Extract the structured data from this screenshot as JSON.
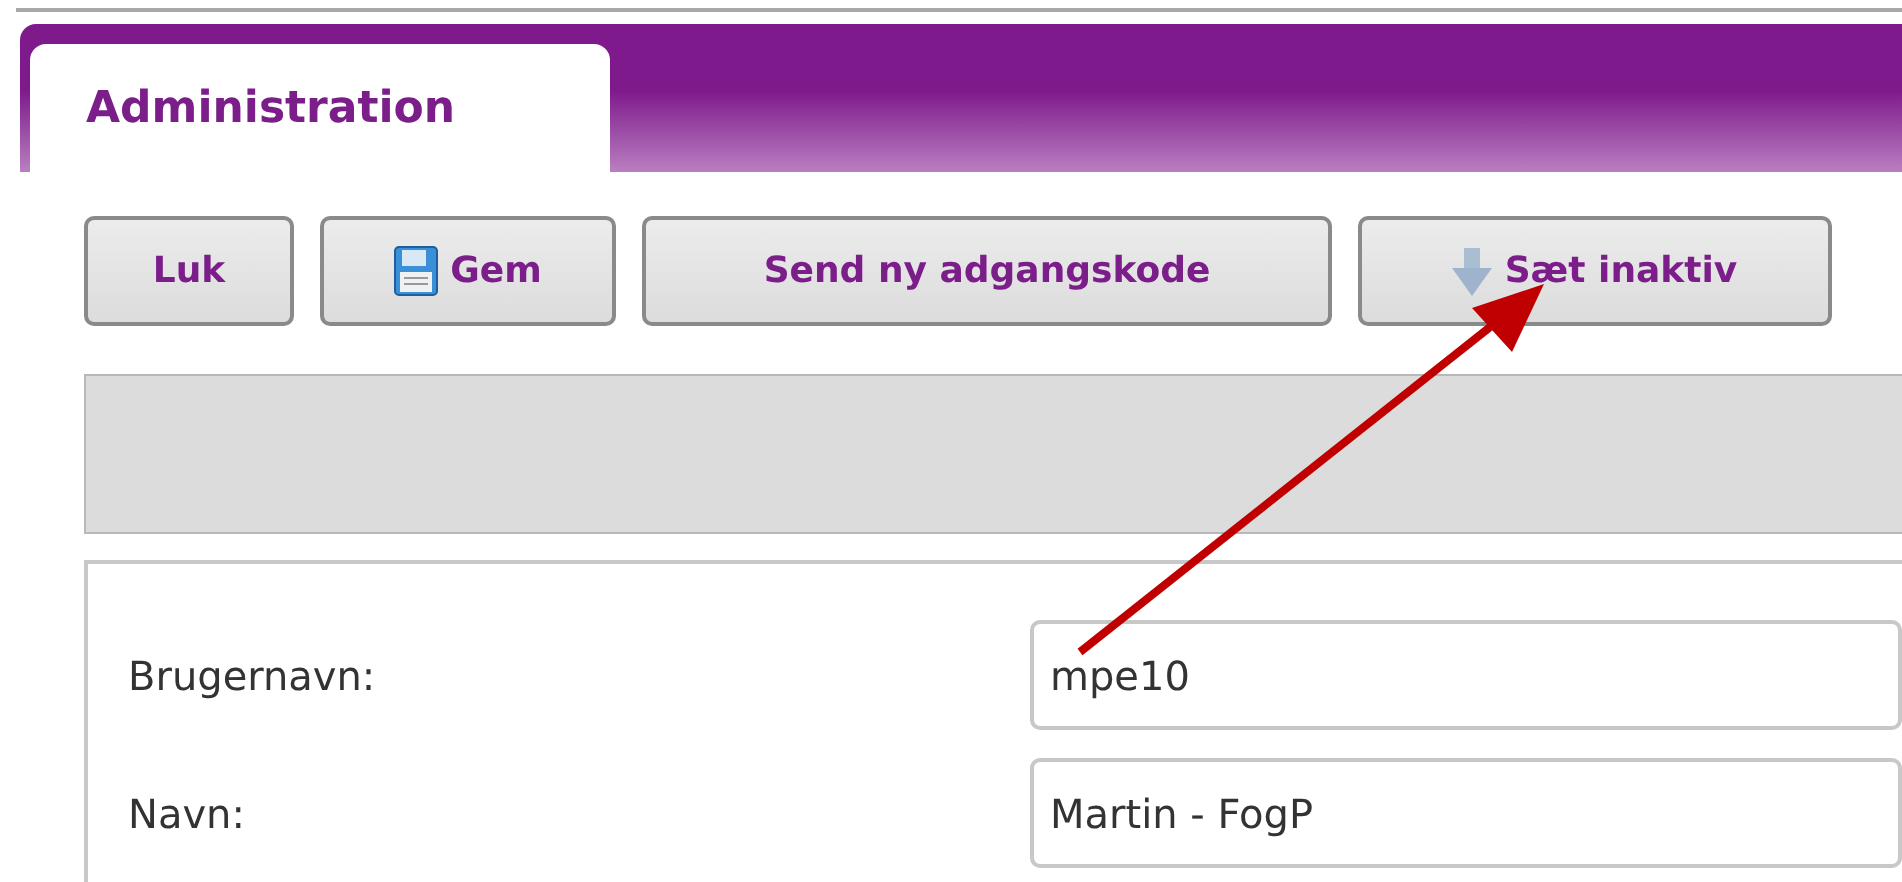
{
  "tabs": [
    {
      "label": "Administration",
      "selected": true
    }
  ],
  "toolbar": [
    {
      "label": "Luk",
      "kind": "plain"
    },
    {
      "label": "Gem",
      "kind": "save"
    },
    {
      "label": "Send ny adgangskode",
      "kind": "plain"
    },
    {
      "label": "Sæt inaktiv",
      "kind": "down"
    }
  ],
  "form": [
    {
      "label": "Brugernavn:",
      "value": "mpe10"
    },
    {
      "label": "Navn:",
      "value": "Martin - FogP"
    }
  ]
}
